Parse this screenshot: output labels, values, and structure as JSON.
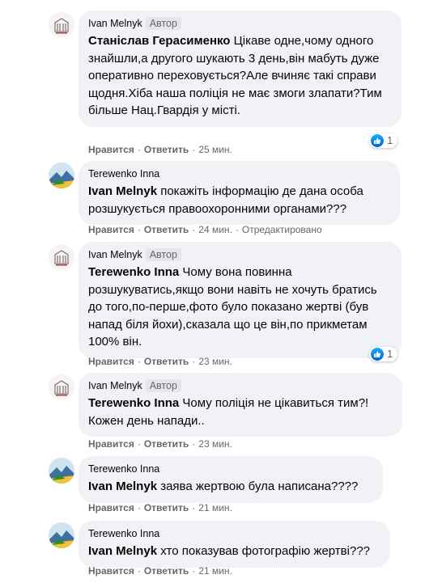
{
  "comments": [
    {
      "author": "Ivan Melnyk",
      "badge": "Автор",
      "mention": "Станіслав Герасименко",
      "text": " Цікаве одне,чому одного знайшли,а другого шукають 3 день,він мабуть дуже оперативно переховується?Але вчиняє такі справи щодня.Хіба наша поліція не має змоги злапати?Тим більше Нац.Гвардія у місті.",
      "like": "Нравится",
      "reply": "Ответить",
      "time": "25 мин.",
      "reactions": "1",
      "edited": ""
    },
    {
      "author": "Terewenko Inna",
      "badge": "",
      "mention": "Ivan Melnyk",
      "text": " покажіть інформацію де дана особа розшукується правоохоронними органами???",
      "like": "Нравится",
      "reply": "Ответить",
      "time": "24 мин.",
      "reactions": "",
      "edited": "Отредактировано"
    },
    {
      "author": "Ivan Melnyk",
      "badge": "Автор",
      "mention": "Terewenko Inna",
      "text": " Чому вона повинна розшукуватись,якщо вони навіть не хочуть братись до того,по-перше,фото було показано жертві (був напад біля йохи),сказала що це він,по прикметам 100% він.",
      "like": "Нравится",
      "reply": "Ответить",
      "time": "23 мин.",
      "reactions": "1",
      "edited": ""
    },
    {
      "author": "Ivan Melnyk",
      "badge": "Автор",
      "mention": "Terewenko Inna",
      "text": " Чому поліція не цікавиться тим?! Кожен день напади..",
      "like": "Нравится",
      "reply": "Ответить",
      "time": "23 мин.",
      "reactions": "",
      "edited": ""
    },
    {
      "author": "Terewenko Inna",
      "badge": "",
      "mention": "Ivan Melnyk",
      "text": " заява жертвою була написана????",
      "like": "Нравится",
      "reply": "Ответить",
      "time": "21 мин.",
      "reactions": "",
      "edited": ""
    },
    {
      "author": "Terewenko Inna",
      "badge": "",
      "mention": "Ivan Melnyk",
      "text": " хто показував фотографію жертві???",
      "like": "Нравится",
      "reply": "Ответить",
      "time": "21 мин.",
      "reactions": "",
      "edited": ""
    }
  ],
  "icons": {
    "ivan_avatar": "building-logo-icon",
    "inna_avatar": "landscape-photo-icon",
    "reaction": "thumbs-up-icon"
  },
  "colors": {
    "bubble": "#f0f2f5",
    "secondary_text": "#65676b",
    "like_blue": "#1877f2"
  }
}
